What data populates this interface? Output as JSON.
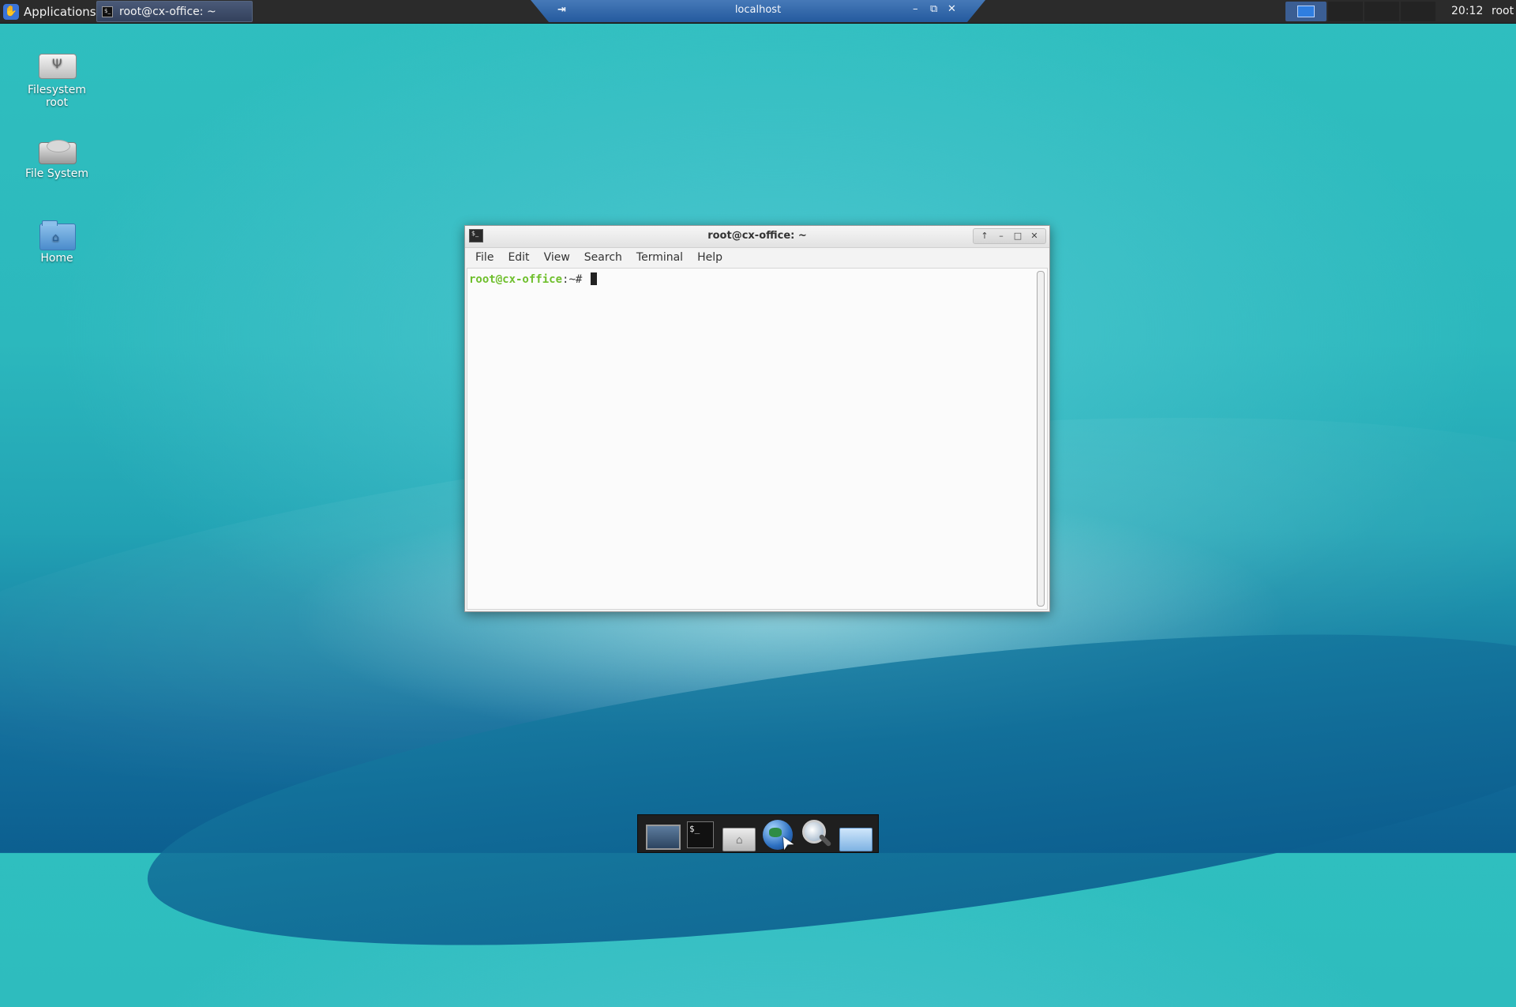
{
  "top_panel": {
    "applications_label": "Applications",
    "task_button_label": "root@cx-office: ~",
    "remote_bar": {
      "host": "localhost",
      "pin_glyph": "⇥",
      "minimize_glyph": "–",
      "restore_glyph": "⧉",
      "close_glyph": "✕"
    },
    "clock": "20:12",
    "user": "root"
  },
  "desktop_icons": [
    {
      "label": "Filesystem root",
      "icon": "usb-drive-icon"
    },
    {
      "label": "File System",
      "icon": "hard-disk-icon"
    },
    {
      "label": "Home",
      "icon": "home-folder-icon"
    }
  ],
  "terminal": {
    "title": "root@cx-office: ~",
    "app_icon_text": "$_",
    "controls": {
      "up": "↑",
      "minimize": "–",
      "maximize": "□",
      "close": "✕"
    },
    "menu": [
      "File",
      "Edit",
      "View",
      "Search",
      "Terminal",
      "Help"
    ],
    "prompt_userhost": "root@cx-office",
    "prompt_path": ":~#"
  },
  "dock": {
    "items": [
      "show-desktop-icon",
      "terminal-icon",
      "home-folder-icon",
      "web-browser-icon",
      "app-finder-icon",
      "file-manager-icon"
    ],
    "terminal_text": "$_",
    "pointer_glyph": "➤"
  },
  "colors": {
    "prompt_green": "#6fbf2d",
    "panel_bg": "#2b2b2b",
    "remote_bar_blue": "#245a9e"
  }
}
